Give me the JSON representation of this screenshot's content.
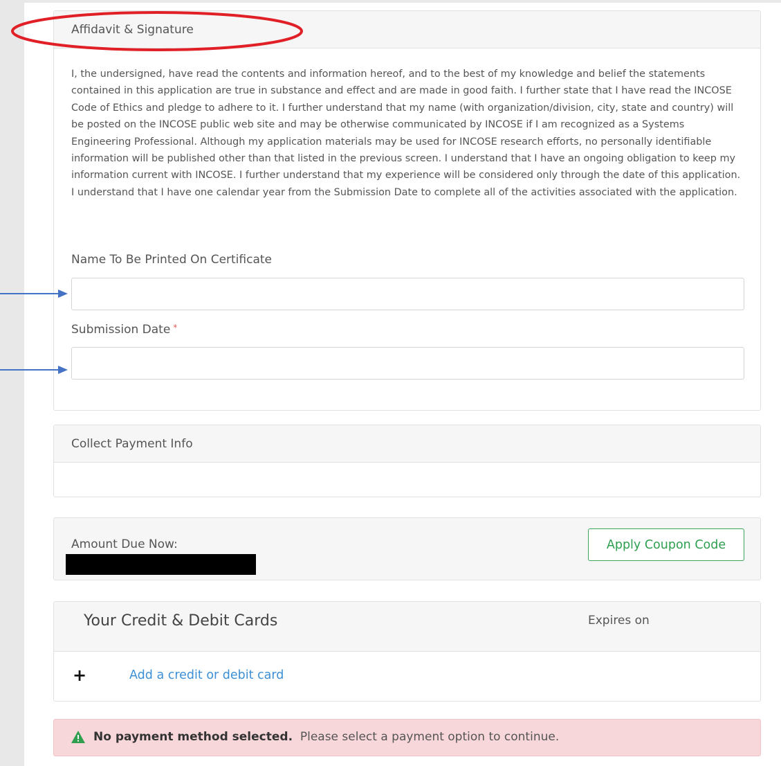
{
  "affidavit": {
    "title": "Affidavit & Signature",
    "text": "I, the undersigned, have read the contents and information hereof, and to the best of my knowledge and belief the statements contained in this application are true in substance and effect and are made in good faith. I further state that I have read the INCOSE Code of Ethics and pledge to adhere to it. I further understand that my name (with organization/division, city, state and country) will be posted on the INCOSE public web site and may be otherwise communicated by INCOSE if I am recognized as a Systems Engineering Professional. Although my application materials may be used for INCOSE research efforts, no personally identifiable information will be published other than that listed in the previous screen. I understand that I have an ongoing obligation to keep my information current with INCOSE. I further understand that my experience will be considered only through the date of this application. I understand that I have one calendar year from the Submission Date to complete all of the activities associated with the application.",
    "name_label": "Name To Be Printed On Certificate",
    "name_value": "",
    "date_label": "Submission Date",
    "date_required_mark": "*",
    "date_value": ""
  },
  "payment": {
    "title": "Collect Payment Info"
  },
  "amount": {
    "label": "Amount Due Now:",
    "coupon_button": "Apply Coupon Code"
  },
  "cards": {
    "title": "Your Credit & Debit Cards",
    "expires_label": "Expires on",
    "add_icon": "+",
    "add_link": "Add a credit or debit card"
  },
  "alert": {
    "icon": "warning-triangle-icon",
    "strong_text": "No payment method selected.",
    "text": "Please select a payment option to continue."
  },
  "colors": {
    "accent_green": "#2e9e4f",
    "link_blue": "#3b8fd6",
    "alert_bg": "#f8d7da",
    "annotation_red": "#e01f26",
    "annotation_blue": "#4472c4"
  }
}
